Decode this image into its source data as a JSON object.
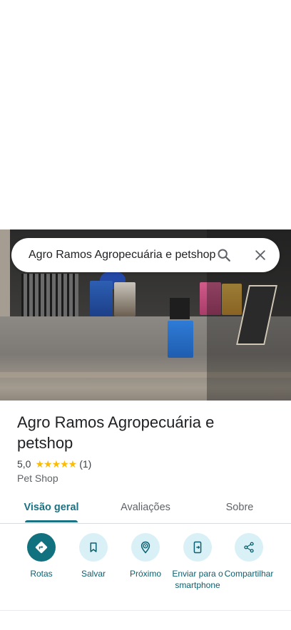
{
  "search": {
    "value": "Agro Ramos Agropecuária e petshop",
    "search_icon": "search-icon",
    "clear_icon": "close-icon"
  },
  "place": {
    "name": "Agro Ramos Agropecuária e petshop",
    "rating": "5,0",
    "stars": "★★★★★",
    "review_count": "(1)",
    "category": "Pet Shop"
  },
  "tabs": [
    {
      "label": "Visão geral",
      "active": true
    },
    {
      "label": "Avaliações",
      "active": false
    },
    {
      "label": "Sobre",
      "active": false
    }
  ],
  "actions": [
    {
      "label": "Rotas",
      "icon": "directions-icon"
    },
    {
      "label": "Salvar",
      "icon": "bookmark-icon"
    },
    {
      "label": "Próximo",
      "icon": "nearby-icon"
    },
    {
      "label": "Enviar para o smartphone",
      "icon": "send-to-phone-icon"
    },
    {
      "label": "Compartilhar",
      "icon": "share-icon"
    }
  ],
  "colors": {
    "accent": "#1a7384",
    "primary_button": "#12717f",
    "button_bg": "#d9f1f6",
    "star": "#fbbc04"
  }
}
